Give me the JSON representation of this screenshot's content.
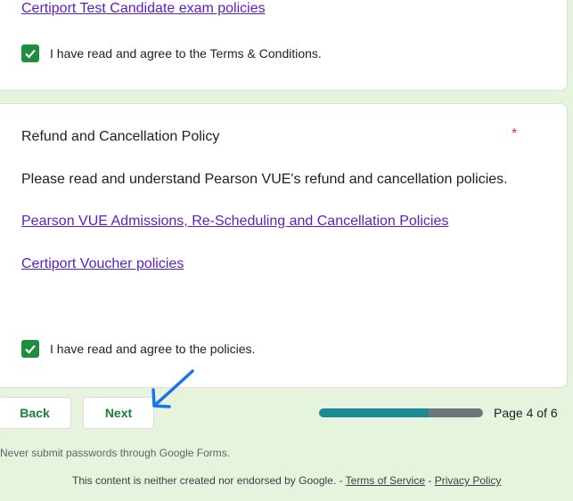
{
  "top_card": {
    "link_label": "Certiport Test Candidate exam policies",
    "checkbox_label": "I have read and agree to the Terms & Conditions."
  },
  "refund_card": {
    "title": "Refund and Cancellation Policy",
    "required_mark": "*",
    "description": "Please read and understand Pearson VUE's refund and cancellation policies.",
    "links": [
      "Pearson VUE Admissions, Re-Scheduling and Cancellation Policies",
      "Certiport Voucher policies"
    ],
    "checkbox_label": "I have read and agree to the policies."
  },
  "navigation": {
    "back_label": "Back",
    "next_label": "Next",
    "progress_fraction": 0.667,
    "page_indicator": "Page 4 of 6"
  },
  "password_warning": "Never submit passwords through Google Forms.",
  "footer": {
    "text": "This content is neither created nor endorsed by Google. -",
    "separator": "-",
    "terms_label": "Terms of Service",
    "privacy_label": "Privacy Policy"
  },
  "colors": {
    "page_background": "#e6f4de",
    "checkbox_green": "#1e8e3e",
    "button_text": "#188038",
    "link": "#5b1fbf",
    "progress_fill": "#1a8a93",
    "annotation_arrow": "#1a73e8"
  },
  "icons": [
    "checkmark-icon",
    "annotation-arrow-icon"
  ]
}
